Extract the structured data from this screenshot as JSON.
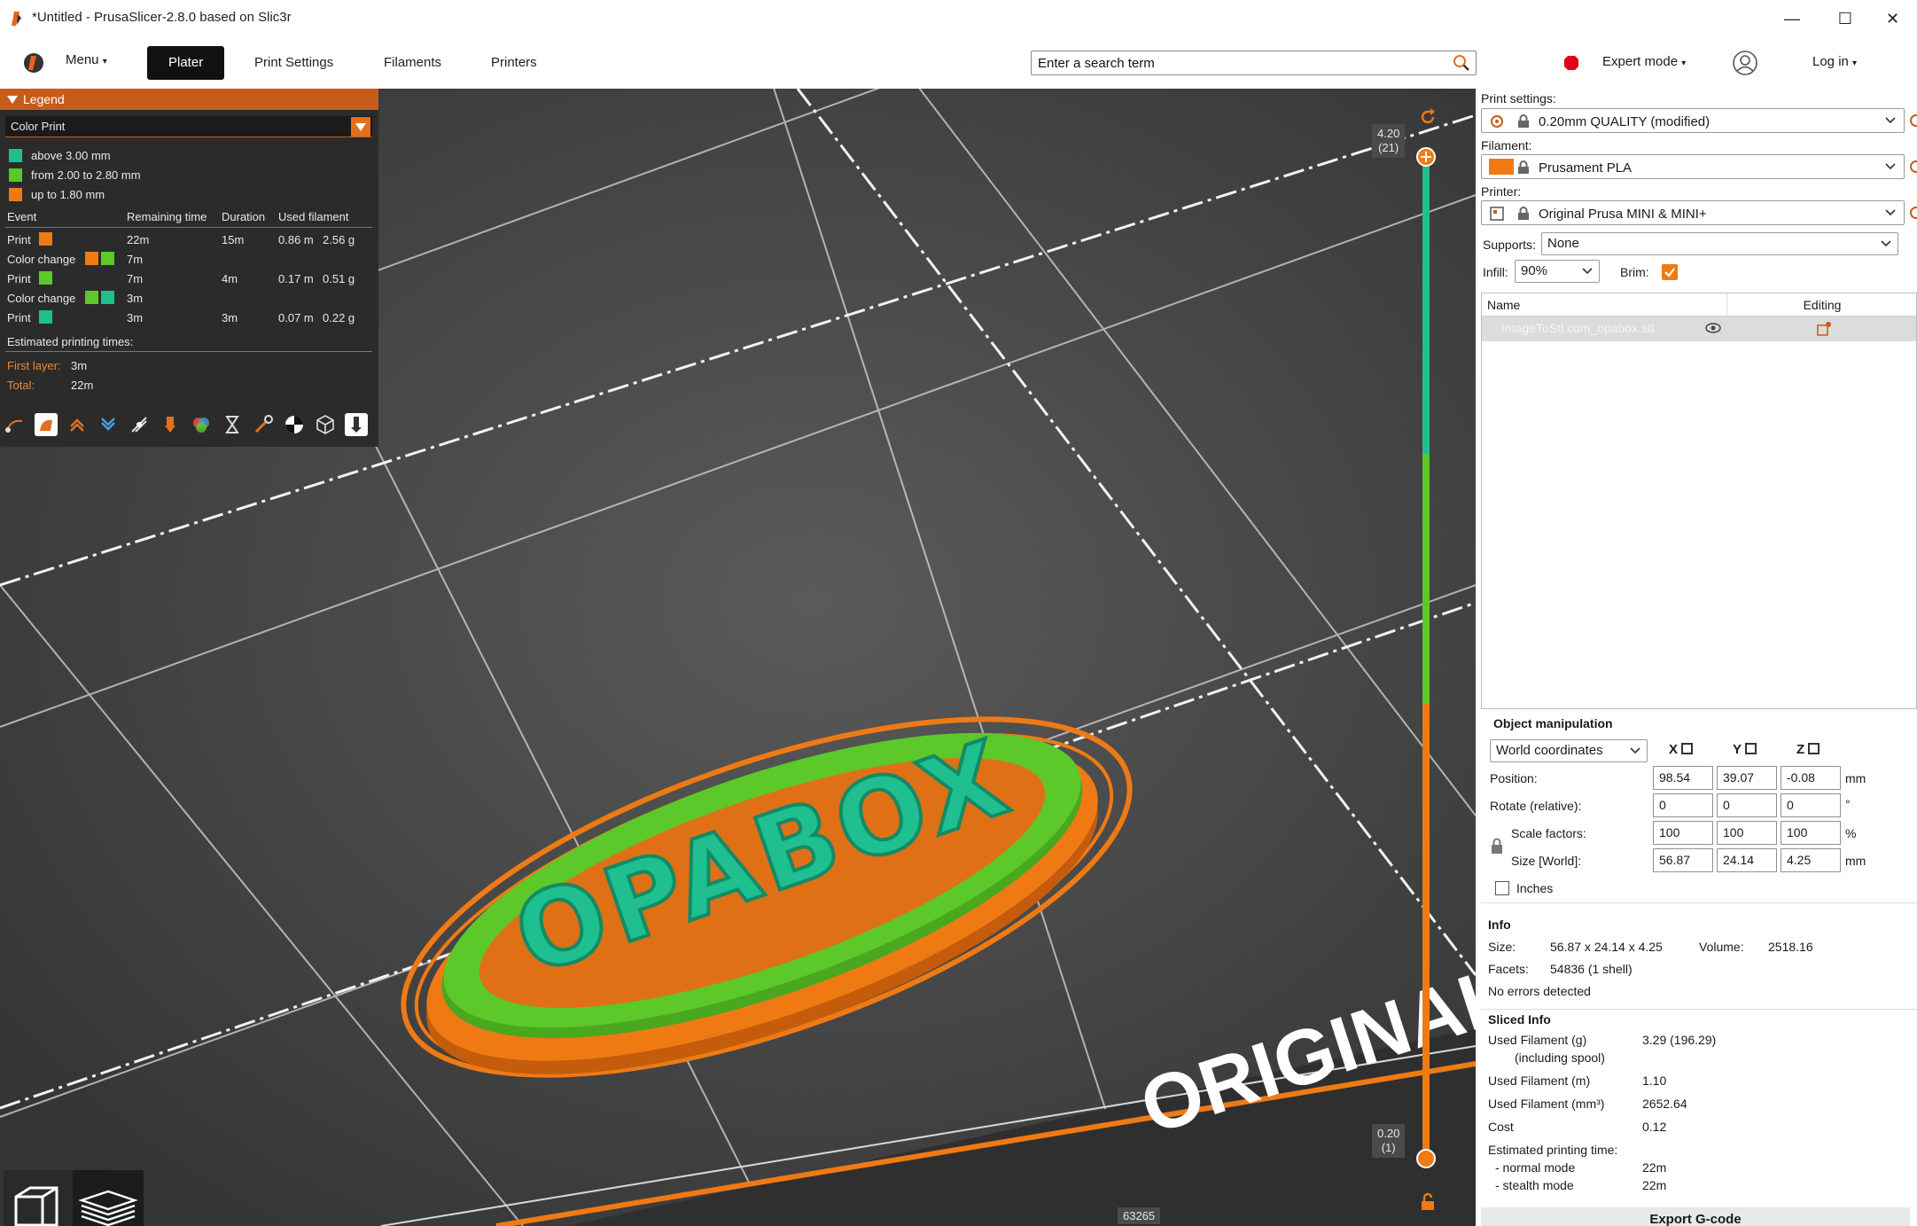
{
  "window": {
    "title": "*Untitled - PrusaSlicer-2.8.0 based on Slic3r",
    "minimize": "—",
    "maximize": "☐",
    "close": "✕"
  },
  "toolbar": {
    "menu_label": "Menu",
    "tabs": [
      "Plater",
      "Print Settings",
      "Filaments",
      "Printers"
    ],
    "search_placeholder": "Enter a search term",
    "mode_label": "Expert mode",
    "login_label": "Log in"
  },
  "legend": {
    "title": "Legend",
    "view_type": "Color Print",
    "ranges": [
      {
        "color": "#1fbf8f",
        "label": "above 3.00 mm"
      },
      {
        "color": "#5cc82a",
        "label": "from 2.00 to 2.80 mm"
      },
      {
        "color": "#ef7a14",
        "label": "up to 1.80 mm"
      }
    ],
    "columns": [
      "Event",
      "Remaining time",
      "Duration",
      "Used filament"
    ],
    "events": [
      {
        "event": "Print",
        "colors": [
          "#ef7a14"
        ],
        "remaining": "22m",
        "duration": "15m",
        "length": "0.86 m",
        "weight": "2.56 g"
      },
      {
        "event": "Color change",
        "colors": [
          "#ef7a14",
          "#5cc82a"
        ],
        "remaining": "7m",
        "duration": "",
        "length": "",
        "weight": ""
      },
      {
        "event": "Print",
        "colors": [
          "#5cc82a"
        ],
        "remaining": "7m",
        "duration": "4m",
        "length": "0.17 m",
        "weight": "0.51 g"
      },
      {
        "event": "Color change",
        "colors": [
          "#5cc82a",
          "#1fbf8f"
        ],
        "remaining": "3m",
        "duration": "",
        "length": "",
        "weight": ""
      },
      {
        "event": "Print",
        "colors": [
          "#1fbf8f"
        ],
        "remaining": "3m",
        "duration": "3m",
        "length": "0.07 m",
        "weight": "0.22 g"
      }
    ],
    "estimated_title": "Estimated printing times:",
    "first_layer_label": "First layer:",
    "first_layer_value": "3m",
    "total_label": "Total:",
    "total_value": "22m"
  },
  "slider": {
    "top_value": "4.20",
    "top_layer": "(21)",
    "bottom_value": "0.20",
    "bottom_layer": "(1)",
    "horizontal_value": "63265"
  },
  "scene": {
    "model_text": "OPABOX",
    "bed_text": "ORIGINAL"
  },
  "panel": {
    "print_settings_label": "Print settings:",
    "print_profile": "0.20mm QUALITY (modified)",
    "filament_label": "Filament:",
    "filament_profile": "Prusament PLA",
    "filament_color": "#ef7a14",
    "printer_label": "Printer:",
    "printer_profile": "Original Prusa MINI & MINI+",
    "supports_label": "Supports:",
    "supports_value": "None",
    "infill_label": "Infill:",
    "infill_value": "90%",
    "brim_label": "Brim:",
    "brim_checked": true,
    "list_name_header": "Name",
    "list_editing_header": "Editing",
    "object_name": "ImageToStl.com_opabox.stl"
  },
  "manipulation": {
    "title": "Object manipulation",
    "coord_system": "World coordinates",
    "axes": [
      "X",
      "Y",
      "Z"
    ],
    "position_label": "Position:",
    "position": [
      "98.54",
      "39.07",
      "-0.08"
    ],
    "position_unit": "mm",
    "rotate_label": "Rotate (relative):",
    "rotate": [
      "0",
      "0",
      "0"
    ],
    "rotate_unit": "°",
    "scale_label": "Scale factors:",
    "scale": [
      "100",
      "100",
      "100"
    ],
    "scale_unit": "%",
    "size_label": "Size [World]:",
    "size": [
      "56.87",
      "24.14",
      "4.25"
    ],
    "size_unit": "mm",
    "inches_label": "Inches"
  },
  "info": {
    "title": "Info",
    "size_label": "Size:",
    "size_value": "56.87 x 24.14 x 4.25",
    "volume_label": "Volume:",
    "volume_value": "2518.16",
    "facets_label": "Facets:",
    "facets_value": "54836 (1 shell)",
    "errors": "No errors detected"
  },
  "sliced_info": {
    "title": "Sliced Info",
    "used_g_label": "Used Filament (g)",
    "used_g_sub": "(including spool)",
    "used_g_value": "3.29 (196.29)",
    "used_m_label": "Used Filament (m)",
    "used_m_value": "1.10",
    "used_mm3_label": "Used Filament (mm³)",
    "used_mm3_value": "2652.64",
    "cost_label": "Cost",
    "cost_value": "0.12",
    "est_label": "Estimated printing time:",
    "normal_label": "- normal mode",
    "normal_value": "22m",
    "stealth_label": "- stealth mode",
    "stealth_value": "22m"
  },
  "export_label": "Export G-code"
}
